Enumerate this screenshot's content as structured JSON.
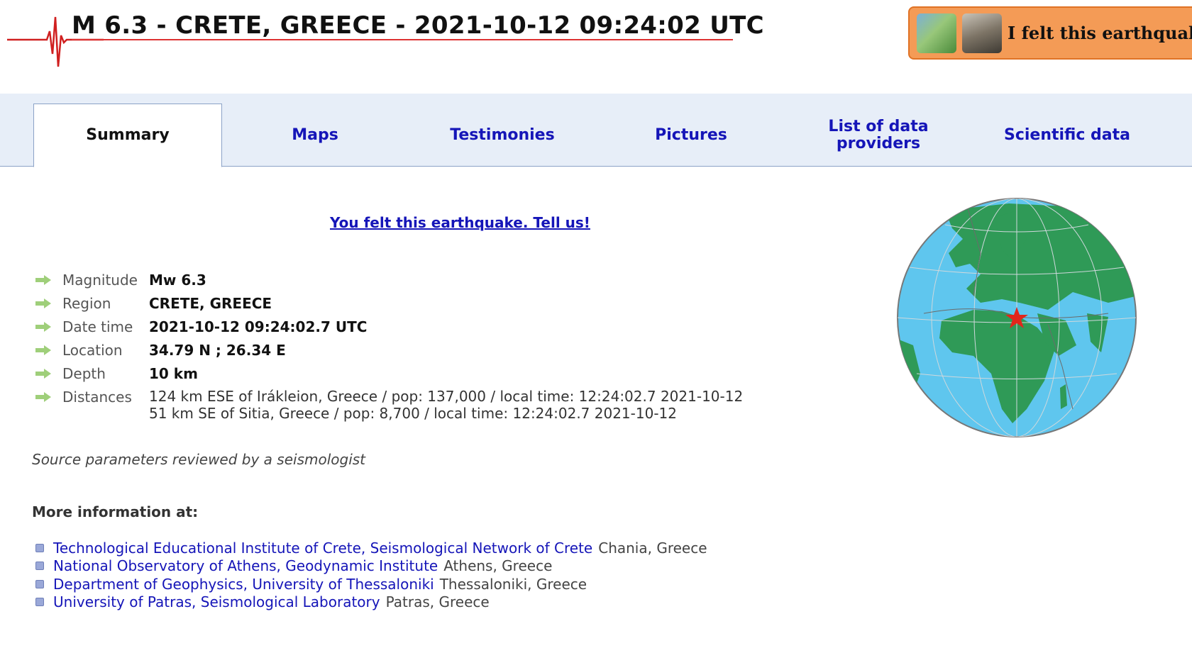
{
  "header": {
    "title": "M 6.3 - CRETE, GREECE - 2021-10-12 09:24:02 UTC",
    "felt_banner_text": "I felt this earthquake"
  },
  "tabs": [
    {
      "label": "Summary",
      "active": true
    },
    {
      "label": "Maps",
      "active": false
    },
    {
      "label": "Testimonies",
      "active": false
    },
    {
      "label": "Pictures",
      "active": false
    },
    {
      "label": "List of data providers",
      "active": false
    },
    {
      "label": "Scientific data",
      "active": false
    }
  ],
  "main": {
    "tell_us_link": "You felt this earthquake. Tell us!",
    "params": [
      {
        "label": "Magnitude",
        "value": "Mw 6.3"
      },
      {
        "label": "Region",
        "value": "CRETE, GREECE"
      },
      {
        "label": "Date time",
        "value": "2021-10-12 09:24:02.7 UTC"
      },
      {
        "label": "Location",
        "value": "34.79 N ; 26.34 E"
      },
      {
        "label": "Depth",
        "value": "10 km"
      }
    ],
    "distances_label": "Distances",
    "distances": [
      "124 km ESE of Irákleion, Greece / pop: 137,000 / local time: 12:24:02.7 2021-10-12",
      "51 km SE of Sitia, Greece / pop: 8,700 / local time: 12:24:02.7 2021-10-12"
    ],
    "source_note": "Source parameters reviewed by a seismologist",
    "more_info_title": "More information at:",
    "more_info": [
      {
        "name": "Technological Educational Institute of Crete, Seismological Network of Crete",
        "location": "Chania, Greece"
      },
      {
        "name": "National Observatory of Athens, Geodynamic Institute",
        "location": "Athens, Greece"
      },
      {
        "name": "Department of Geophysics, University of Thessaloniki",
        "location": "Thessaloniki, Greece"
      },
      {
        "name": "University of Patras, Seismological Laboratory",
        "location": "Patras, Greece"
      }
    ]
  },
  "colors": {
    "link": "#1515b8",
    "tab_bar_bg": "#e7eef8",
    "banner_bg": "#f49b56",
    "ocean": "#5fc6ee",
    "land": "#2f9a57",
    "epicenter": "#e2261b"
  }
}
